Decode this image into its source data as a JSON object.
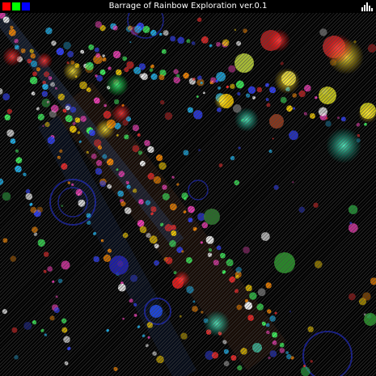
{
  "window": {
    "title": "Barrage of Rainbow Exploration ver.0.1"
  },
  "toolbar": {
    "swatches": [
      {
        "name": "red-swatch",
        "color": "#ff0000"
      },
      {
        "name": "green-swatch",
        "color": "#00ff00"
      },
      {
        "name": "blue-swatch",
        "color": "#0000ff"
      }
    ],
    "meter_icon": "sound-level-icon"
  },
  "scene": {
    "background": "#000000",
    "palette": [
      "#ff2a2a",
      "#ffd400",
      "#40ff60",
      "#20c0ff",
      "#3040ff",
      "#ff40c0",
      "#ff8a00",
      "#ffffff"
    ]
  }
}
